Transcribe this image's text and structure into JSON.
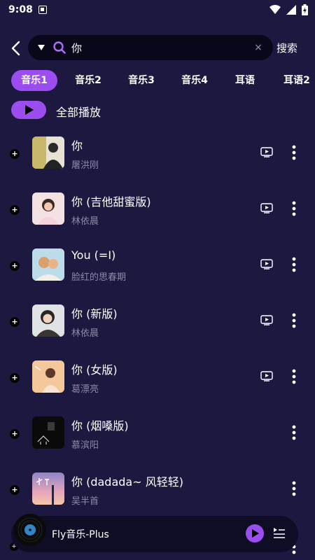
{
  "status": {
    "time": "9:08"
  },
  "search": {
    "query": "你",
    "clear": "×",
    "button": "搜索"
  },
  "tabs": [
    "音乐1",
    "音乐2",
    "音乐3",
    "音乐4",
    "耳语",
    "耳语2"
  ],
  "play_all": {
    "label": "全部播放"
  },
  "songs": [
    {
      "title": "你",
      "artist": "屠洪刚",
      "has_mv": true
    },
    {
      "title": "你 (吉他甜蜜版)",
      "artist": "林依晨",
      "has_mv": true
    },
    {
      "title": "You (=I)",
      "artist": "脸红的思春期",
      "has_mv": true
    },
    {
      "title": "你 (新版)",
      "artist": "林依晨",
      "has_mv": true
    },
    {
      "title": "你 (女版)",
      "artist": "葛漂亮",
      "has_mv": true
    },
    {
      "title": "你 (烟嗓版)",
      "artist": "慕滨阳",
      "has_mv": false
    },
    {
      "title": "你 (dadada~ 风轻轻)",
      "artist": "吴半首",
      "has_mv": false
    }
  ],
  "player": {
    "title": "Fly音乐-Plus"
  },
  "colors": {
    "background": "#1c1840",
    "accent": "#9b4df0",
    "search_bg": "#09081a",
    "muted_text": "#8c89a6"
  }
}
